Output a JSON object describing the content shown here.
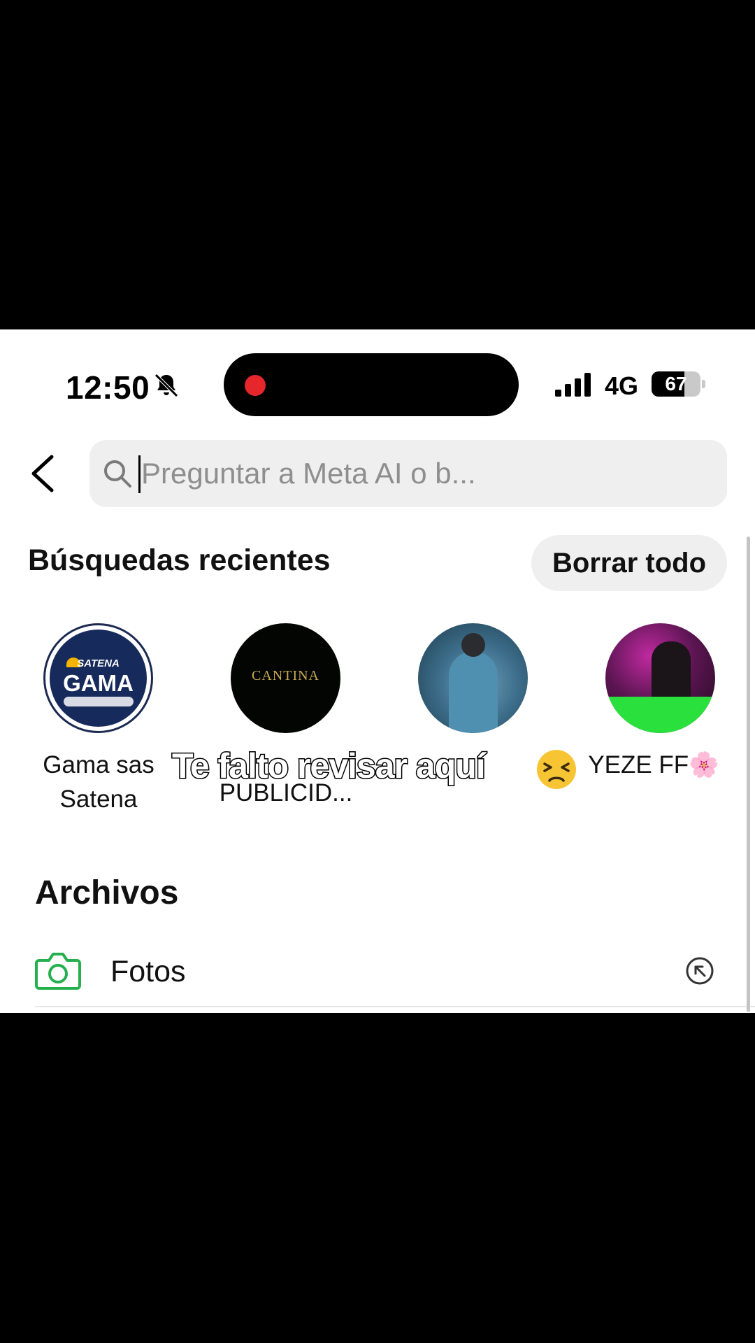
{
  "status_bar": {
    "time": "12:50",
    "network": "4G",
    "battery_percent": 67
  },
  "search": {
    "placeholder": "Preguntar a Meta AI o b..."
  },
  "recent": {
    "title": "Búsquedas recientes",
    "clear_label": "Borrar todo",
    "items": [
      {
        "name": "Gama sas Satena",
        "avatar_text": [
          "SATENA",
          "GAMA"
        ]
      },
      {
        "name": "PUBLICID...",
        "avatar_text": [
          "CANTINA"
        ]
      },
      {
        "name": "",
        "avatar_text": []
      },
      {
        "name": "YEZE FF🌸",
        "avatar_text": []
      }
    ]
  },
  "files": {
    "title": "Archivos",
    "items": [
      {
        "label": "Fotos",
        "icon": "camera-icon"
      }
    ]
  },
  "overlay_caption": {
    "text": "Te falto revisar aquí"
  },
  "colors": {
    "accent_green": "#25b04d",
    "recording_red": "#e5262a",
    "pill_gray": "#efefef"
  }
}
